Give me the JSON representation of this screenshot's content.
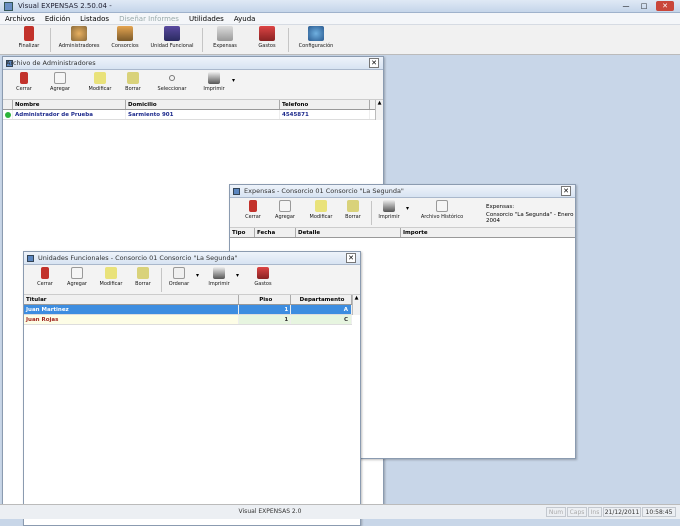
{
  "app": {
    "title": "Visual EXPENSAS 2.50.04 -"
  },
  "menu": [
    "Archivos",
    "Edición",
    "Listados",
    "Diseñar Informes",
    "Utilidades",
    "Ayuda"
  ],
  "main_toolbar": [
    "Finalizar",
    "Administradores",
    "Consorcios",
    "Unidad Funcional",
    "Expensas",
    "Gastos",
    "Configuración"
  ],
  "admins_window": {
    "title": "Archivo de Administradores",
    "toolbar": [
      "Cerrar",
      "Agregar",
      "Modificar",
      "Borrar",
      "Seleccionar",
      "Imprimir"
    ],
    "columns": [
      "Nombre",
      "Domicilio",
      "Telefono"
    ],
    "rows": [
      {
        "nombre": "Administrador de Prueba",
        "domicilio": "Sarmiento 901",
        "telefono": "4545871"
      }
    ]
  },
  "expensas_window": {
    "title": "Expensas - Consorcio 01 Consorcio \"La Segunda\"",
    "toolbar": [
      "Cerrar",
      "Agregar",
      "Modificar",
      "Borrar",
      "Imprimir",
      "Archivo Histórico"
    ],
    "info_label": "Expensas:",
    "info_value": "Consorcio \"La Segunda\" - Enero 2004",
    "columns": [
      "Tipo",
      "Fecha",
      "Detalle",
      "Importe"
    ]
  },
  "unidades_window": {
    "title": "Unidades Funcionales - Consorcio 01 Consorcio \"La Segunda\"",
    "toolbar": [
      "Cerrar",
      "Agregar",
      "Modificar",
      "Borrar",
      "Ordenar",
      "Imprimir",
      "Gastos"
    ],
    "columns": [
      "Titular",
      "Piso",
      "Departamento"
    ],
    "rows": [
      {
        "titular": "Juan Martinez",
        "piso": "1",
        "depto": "A"
      },
      {
        "titular": "Juan Rojas",
        "piso": "1",
        "depto": "C"
      }
    ]
  },
  "status": {
    "center": "Visual EXPENSAS 2.0",
    "num": "Num",
    "caps": "Caps",
    "ins": "Ins",
    "date": "21/12/2011",
    "time": "10:58:45"
  }
}
